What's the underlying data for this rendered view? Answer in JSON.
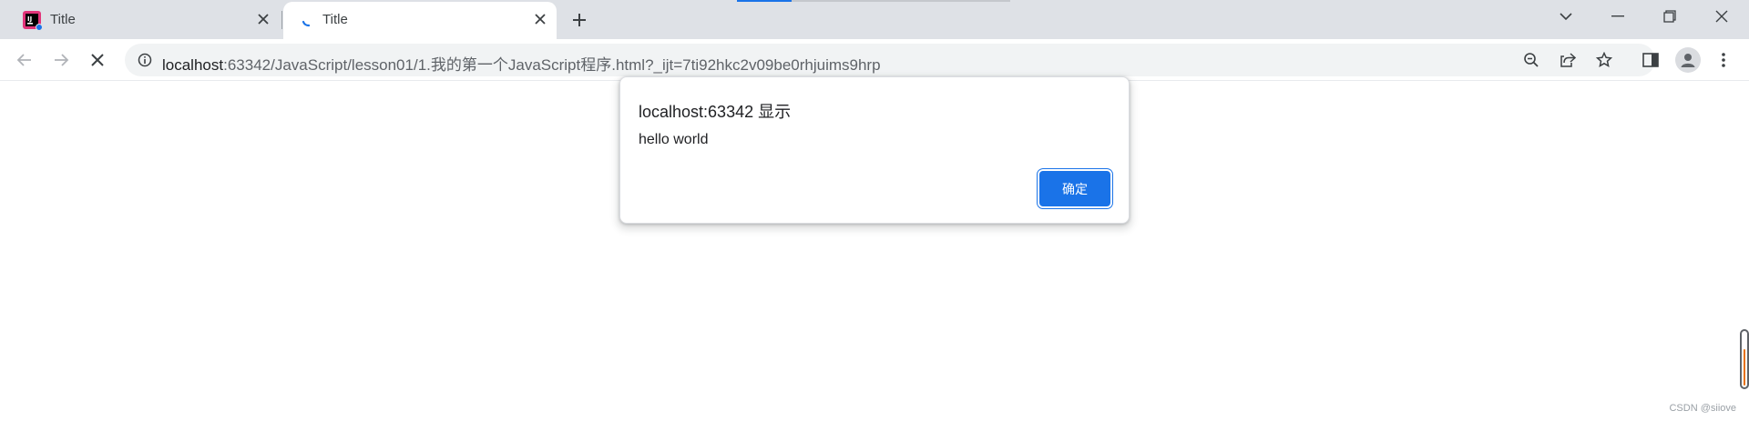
{
  "browser": {
    "tabs": [
      {
        "title": "Title",
        "favicon": "intellij-idea-icon",
        "active": false
      },
      {
        "title": "Title",
        "favicon": "loading-spinner-icon",
        "active": true
      }
    ],
    "new_tab_icon": "plus-icon",
    "window_controls": [
      "chevron-down-icon",
      "minimize-icon",
      "restore-icon",
      "close-icon"
    ]
  },
  "toolbar": {
    "url_host": "localhost",
    "url_rest": ":63342/JavaScript/lesson01/1.我的第一个JavaScript程序.html?_ijt=7ti92hkc2v09be0rhjuims9hrp",
    "nav_icons": [
      "back-arrow-icon",
      "forward-arrow-icon",
      "stop-loading-icon"
    ],
    "omnibox_actions": [
      "zoom-out-icon",
      "share-icon",
      "bookmark-star-icon"
    ],
    "right_icons": [
      "side-panel-icon",
      "profile-avatar-icon",
      "more-menu-icon"
    ]
  },
  "dialog": {
    "title": "localhost:63342 显示",
    "message": "hello world",
    "ok_label": "确定"
  },
  "footer": {
    "watermark": "CSDN @siiove"
  },
  "colors": {
    "accent": "#1a73e8",
    "tabstrip": "#dee1e6",
    "omnibox": "#f1f3f4"
  }
}
